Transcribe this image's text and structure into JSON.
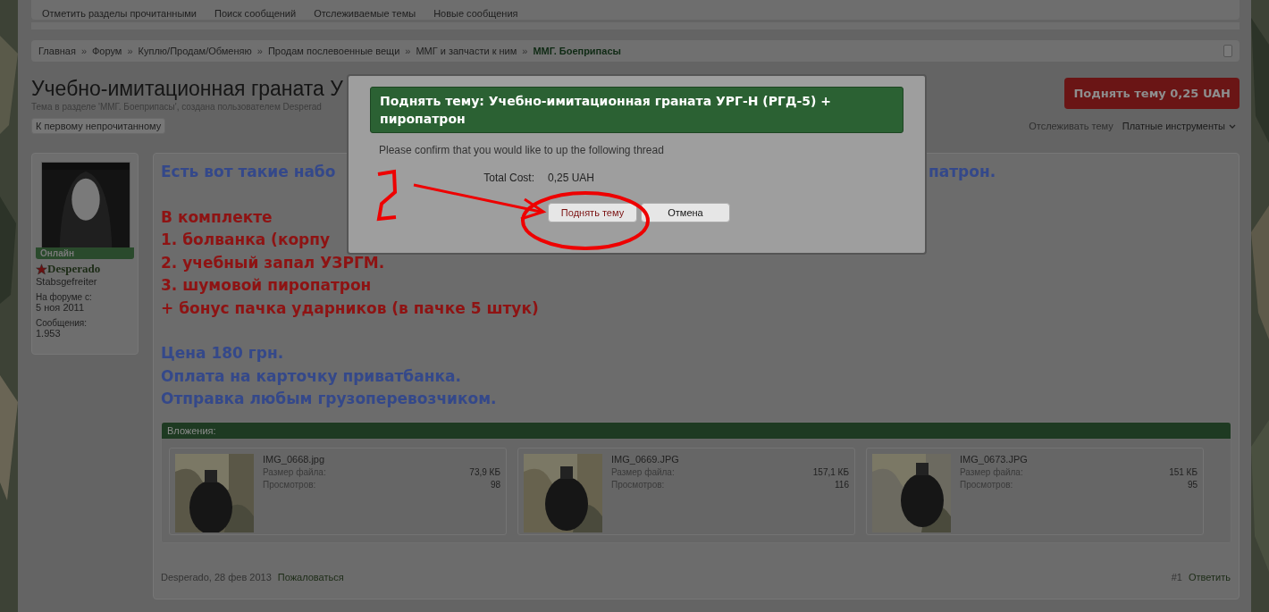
{
  "top_nav": {
    "links": [
      "Отметить разделы прочитанными",
      "Поиск сообщений",
      "Отслеживаемые темы",
      "Новые сообщения"
    ]
  },
  "breadcrumbs": [
    {
      "label": "Главная",
      "current": false
    },
    {
      "label": "Форум",
      "current": false
    },
    {
      "label": "Куплю/Продам/Обменяю",
      "current": false
    },
    {
      "label": "Продам послевоенные вещи",
      "current": false
    },
    {
      "label": "ММГ и запчасти к ним",
      "current": false
    },
    {
      "label": "ММГ. Боеприпасы",
      "current": true
    }
  ],
  "breadcrumb_separator": "»",
  "thread": {
    "title": "Учебно-имитационная граната У",
    "subtitle": "Тема в разделе 'ММГ. Боеприпасы', создана пользователем Desperad",
    "bump_button": "Поднять тему 0,25 UAH",
    "first_unread_button": "К первому непрочитанному",
    "watch_link": "Отслеживать тему",
    "tools_menu": "Платные инструменты"
  },
  "post": {
    "author": {
      "status": "Онлайн",
      "name": "Desperado",
      "rank": "Stabsgefreiter",
      "joined_label": "На форуме с:",
      "joined": "5 ноя 2011",
      "messages_label": "Сообщения:",
      "messages": "1.953"
    },
    "paragraphs": [
      {
        "color": "#34488a",
        "lines": [
          {
            "text": "Есть вот такие набо",
            "text_after_dialog": "патрон."
          }
        ]
      },
      {
        "color": "#8e1313",
        "lines": [
          {
            "text": "В комплекте"
          },
          {
            "text": "1. болванка (корпу"
          },
          {
            "text": "2. учебный запал УЗРГМ."
          },
          {
            "text": "3. шумовой пиропатрон"
          },
          {
            "text": "+ бонус пачка ударников (в пачке 5 штук)"
          }
        ]
      },
      {
        "color": "#34488a",
        "lines": [
          {
            "text": "Цена 180 грн."
          },
          {
            "text": "Оплата на карточку приватбанка."
          },
          {
            "text": "Отправка любым грузоперевозчиком."
          }
        ]
      }
    ],
    "attachments": {
      "title": "Вложения:",
      "items": [
        {
          "name": "IMG_0668.jpg",
          "size_label": "Размер файла:",
          "size": "73,9 КБ",
          "views_label": "Просмотров:",
          "views": "98"
        },
        {
          "name": "IMG_0669.JPG",
          "size_label": "Размер файла:",
          "size": "157,1 КБ",
          "views_label": "Просмотров:",
          "views": "116"
        },
        {
          "name": "IMG_0673.JPG",
          "size_label": "Размер файла:",
          "size": "151 КБ",
          "views_label": "Просмотров:",
          "views": "95"
        }
      ]
    },
    "footer": {
      "author_date": "Desperado, 28 фев 2013",
      "report_link": "Пожаловаться",
      "number": "#1",
      "reply_link": "Ответить"
    }
  },
  "dialog": {
    "title": "Поднять тему: Учебно-имитационная граната УРГ-Н (РГД-5) + пиропатрон",
    "message": "Please confirm that you would like to up the following thread",
    "cost_label": "Total Cost:",
    "cost": "0,25 UAH",
    "buttons": [
      {
        "label": "Поднять тему",
        "kind": "primary"
      },
      {
        "label": "Отмена",
        "kind": "secondary"
      }
    ]
  }
}
